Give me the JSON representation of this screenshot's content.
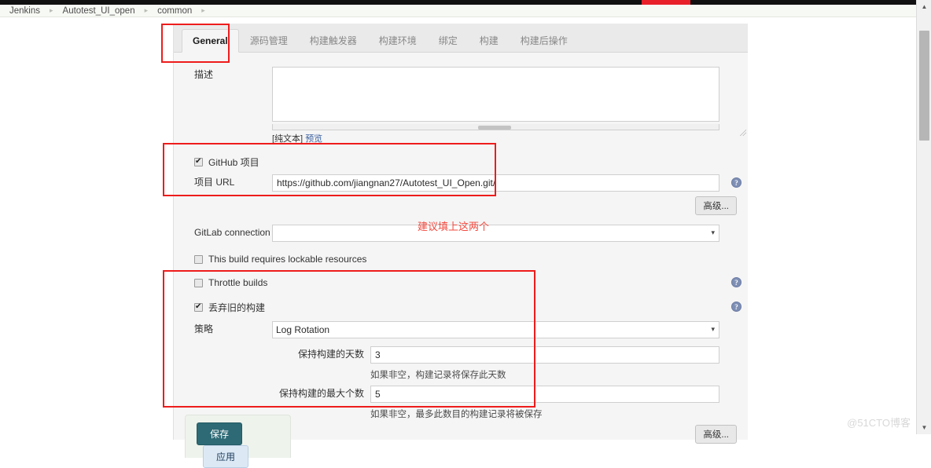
{
  "breadcrumb": {
    "items": [
      {
        "label": "Jenkins"
      },
      {
        "label": "Autotest_UI_open"
      },
      {
        "label": "common"
      }
    ],
    "separator": "▸"
  },
  "tabs": [
    {
      "label": "General",
      "active": true
    },
    {
      "label": "源码管理",
      "active": false
    },
    {
      "label": "构建触发器",
      "active": false
    },
    {
      "label": "构建环境",
      "active": false
    },
    {
      "label": "绑定",
      "active": false
    },
    {
      "label": "构建",
      "active": false
    },
    {
      "label": "构建后操作",
      "active": false
    }
  ],
  "form": {
    "description": {
      "label": "描述",
      "value": "",
      "placeholder": "",
      "plain_text_label": "[纯文本]",
      "preview_label": "预览"
    },
    "github_project": {
      "checkbox_label": "GitHub 项目",
      "checked": true,
      "url_label": "项目 URL",
      "url_value": "https://github.com/jiangnan27/Autotest_UI_Open.git/",
      "advanced_label": "高级...",
      "help_icon": "help-icon"
    },
    "gitlab_connection": {
      "label": "GitLab connection",
      "selected": "",
      "options": [
        ""
      ]
    },
    "lockable_resources": {
      "label": "This build requires lockable resources",
      "checked": false
    },
    "throttle_builds": {
      "label": "Throttle builds",
      "checked": false,
      "help_icon": "help-icon"
    },
    "discard_old_builds": {
      "checkbox_label": "丢弃旧的构建",
      "checked": true,
      "help_icon": "help-icon",
      "strategy_label": "策略",
      "strategy_selected": "Log Rotation",
      "strategy_options": [
        "Log Rotation"
      ],
      "days_to_keep": {
        "label": "保持构建的天数",
        "value": "3",
        "hint": "如果非空，构建记录将保存此天数"
      },
      "max_builds_to_keep": {
        "label": "保持构建的最大个数",
        "value": "5",
        "hint": "如果非空，最多此数目的构建记录将被保存"
      },
      "advanced_label": "高级..."
    }
  },
  "actions": {
    "save_label": "保存",
    "apply_label": "应用",
    "save_color": "#2d6a75",
    "apply_color": "#dce9f5"
  },
  "annotations": {
    "color": "#ee1c1c",
    "text_color": "#f2493f",
    "note": "建议填上这两个",
    "boxes": [
      {
        "name": "general-tab-highlight"
      },
      {
        "name": "github-project-highlight"
      },
      {
        "name": "discard-old-builds-highlight"
      }
    ]
  },
  "scrollbar": {
    "up_arrow": "▲",
    "down_arrow": "▼"
  },
  "watermark": {
    "text": "@51CTO博客"
  }
}
